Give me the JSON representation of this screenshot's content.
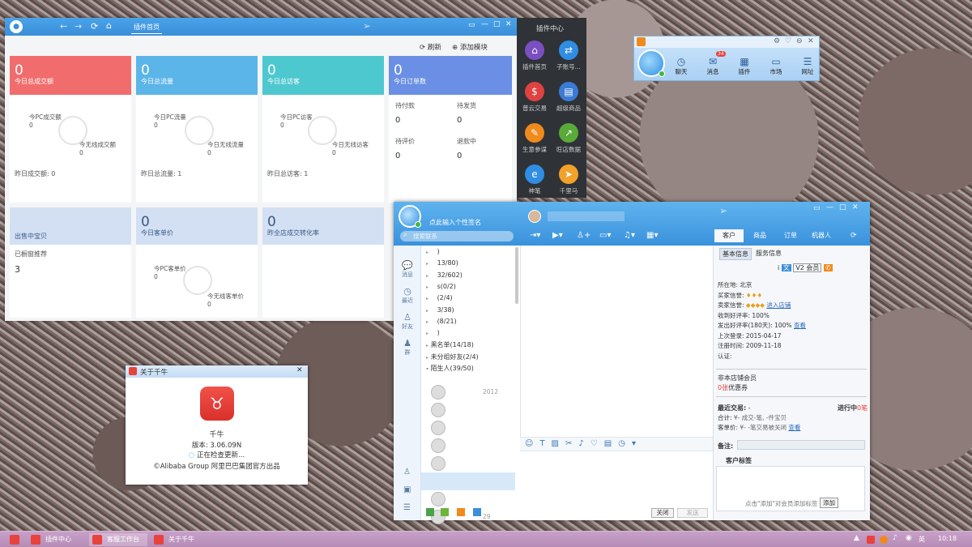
{
  "plugin_window": {
    "tab": "插件首页",
    "refresh": "刷新",
    "add_module": "添加模块",
    "cards": [
      {
        "value": "0",
        "label": "今日总成交额",
        "color": "#f16d6d",
        "a_label": "今PC成交额",
        "a_val": "0",
        "b_label": "今无线成交额",
        "b_val": "0",
        "footer": "昨日成交额: 0"
      },
      {
        "value": "0",
        "label": "今日总流量",
        "color": "#5bb5e8",
        "a_label": "今日PC流量",
        "a_val": "0",
        "b_label": "今日无线流量",
        "b_val": "0",
        "footer": "昨日总流量: 1"
      },
      {
        "value": "0",
        "label": "今日总访客",
        "color": "#4ec8cf",
        "a_label": "今日PC访客",
        "a_val": "0",
        "b_label": "今日无线访客",
        "b_val": "0",
        "footer": "昨日总访客: 1"
      }
    ],
    "orders": {
      "value": "0",
      "label": "今日订单数",
      "color": "#6a8fe4",
      "items": [
        {
          "label": "待付款",
          "val": "0"
        },
        {
          "label": "待发货",
          "val": "0"
        },
        {
          "label": "待评价",
          "val": "0"
        },
        {
          "label": "退款中",
          "val": "0"
        }
      ]
    },
    "row2": [
      {
        "label": "出售中宝贝",
        "sub": "已橱窗推荐",
        "val": "3"
      },
      {
        "value": "0",
        "label": "今日客单价",
        "a_label": "今PC客单价",
        "a_val": "0",
        "b_label": "今无线客单价",
        "b_val": "0"
      },
      {
        "value": "0",
        "label": "昨全店成交转化率"
      }
    ]
  },
  "plugin_center": {
    "title": "插件中心",
    "items": [
      {
        "label": "插件首页",
        "icon": "home-icon",
        "color": "#7a4fc2",
        "glyph": "⌂"
      },
      {
        "label": "子账号...",
        "icon": "subaccount-icon",
        "color": "#2f8de4",
        "glyph": "⇄"
      },
      {
        "label": "普云交易",
        "icon": "trade-icon",
        "color": "#e04141",
        "glyph": "$"
      },
      {
        "label": "超级商品",
        "icon": "goods-icon",
        "color": "#3a7bd5",
        "glyph": "▤"
      },
      {
        "label": "生意参谋",
        "icon": "advisor-icon",
        "color": "#f08a1c",
        "glyph": "✎"
      },
      {
        "label": "旺店数据",
        "icon": "data-icon",
        "color": "#5aaa3a",
        "glyph": "↗"
      },
      {
        "label": "神笔",
        "icon": "pen-icon",
        "color": "#2f8de4",
        "glyph": "e"
      },
      {
        "label": "千里马",
        "icon": "horse-icon",
        "color": "#f2a12b",
        "glyph": "➤"
      }
    ]
  },
  "toolbar": {
    "items": [
      {
        "label": "聊天",
        "glyph": "◷"
      },
      {
        "label": "消息",
        "glyph": "✉",
        "badge": "34"
      },
      {
        "label": "插件",
        "glyph": "▦"
      },
      {
        "label": "市场",
        "glyph": "▭"
      },
      {
        "label": "网址",
        "glyph": "☰"
      }
    ]
  },
  "about": {
    "title": "关于千牛",
    "app": "千牛",
    "version": "版本: 3.06.09N",
    "checking": "正在检查更新...",
    "copyright": "©Alibaba Group 阿里巴巴集团官方出品"
  },
  "chat": {
    "signature": "点此输入个性签名",
    "search_placeholder": "搜索联系",
    "side": [
      {
        "label": "消息",
        "glyph": "💬"
      },
      {
        "label": "最近",
        "glyph": "◷"
      },
      {
        "label": "好友",
        "glyph": "♙"
      },
      {
        "label": "群",
        "glyph": "♟"
      }
    ],
    "groups": [
      ")",
      "13/80)",
      "32/602)",
      "s(0/2)",
      "(2/4)",
      "3/38)",
      "(8/21)",
      ")",
      "黑名单(14/18)",
      "未分组好友(2/4)",
      "陌生人(39/50)"
    ],
    "contacts": [
      "2012",
      "",
      "",
      "",
      "",
      "2012",
      "",
      "29"
    ],
    "tabs": [
      "客户",
      "商品",
      "订单",
      "机器人"
    ],
    "subtabs": [
      "基本信息",
      "服务信息"
    ],
    "info": [
      {
        "k": "所在地:",
        "v": "北京"
      },
      {
        "k": "买家信誉:",
        "v": "♦♦♦"
      },
      {
        "k": "卖家信誉:",
        "v": "◆◆◆◆",
        "link": "进入店铺"
      },
      {
        "k": "收到好评率:",
        "v": "100%"
      },
      {
        "k": "发出好评率(180天):",
        "v": "100%",
        "link": "查看"
      },
      {
        "k": "上次登录:",
        "v": "2015-04-17"
      },
      {
        "k": "注册时间:",
        "v": "2009-11-18"
      },
      {
        "k": "认证:",
        "v": ""
      }
    ],
    "member": "非本店铺会员",
    "coupon_prefix": "0张",
    "coupon": "优惠券",
    "recent": "最近交易:",
    "recent_v": "-",
    "in_progress": "进行中",
    "in_progress_v": "0笔",
    "total": "合计:",
    "total_v": "¥-  成交-笔, -件宝贝",
    "avg": "客单价:",
    "avg_v": "¥-  -笔交易被关闭",
    "avg_link": "查看",
    "note": "备注:",
    "tag_title": "客户标签",
    "tag_hint": "点击\"添加\"对会员添加标签",
    "tag_add": "添加",
    "close": "关闭",
    "send": "发送"
  },
  "taskbar": {
    "items": [
      "插件中心",
      "客服工作台",
      "关于千牛"
    ],
    "time": "10:18",
    "ime": "英"
  }
}
